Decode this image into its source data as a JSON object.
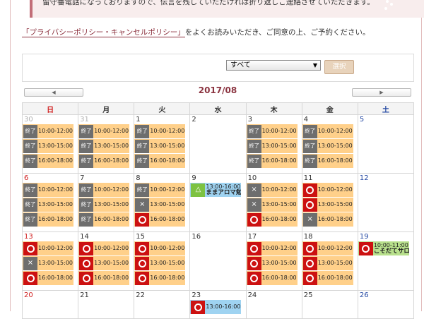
{
  "notice": {
    "text": "留守番電話になっておりますので、伝言を残していただければ折り返しご連絡させていただきます。"
  },
  "policy": {
    "link_text": "「プライバシーポリシー・キャンセルポリシー」",
    "suffix": "をよくお読みいただき、ご同意の上、ご予約ください。"
  },
  "filter": {
    "selected": "すべて",
    "button_label": "選択"
  },
  "nav": {
    "prev": "◀",
    "next": "▶",
    "month": "2017/08"
  },
  "weekdays": [
    "日",
    "月",
    "火",
    "水",
    "木",
    "金",
    "土"
  ],
  "status_labels": {
    "done": "終了",
    "available": "○",
    "full": "×",
    "few": "△"
  },
  "colors": {
    "slot": "#ffd08a",
    "available": "#cc1111",
    "done": "#6e6e6e",
    "few": "#7dc242",
    "event_blue": "#9fd3f1",
    "event_green": "#b8e08c"
  },
  "weeks": [
    [
      {
        "day": "30",
        "other": true,
        "slots": [
          {
            "status": "done",
            "label": "終了",
            "time": "10:00-12:00"
          },
          {
            "status": "done",
            "label": "終了",
            "time": "13:00-15:00"
          },
          {
            "status": "done",
            "label": "終了",
            "time": "16:00-18:00"
          }
        ]
      },
      {
        "day": "31",
        "other": true,
        "slots": [
          {
            "status": "done",
            "label": "終了",
            "time": "10:00-12:00"
          },
          {
            "status": "done",
            "label": "終了",
            "time": "13:00-15:00"
          },
          {
            "status": "done",
            "label": "終了",
            "time": "16:00-18:00"
          }
        ]
      },
      {
        "day": "1",
        "slots": [
          {
            "status": "done",
            "label": "終了",
            "time": "10:00-12:00"
          },
          {
            "status": "done",
            "label": "終了",
            "time": "13:00-15:00"
          },
          {
            "status": "done",
            "label": "終了",
            "time": "16:00-18:00"
          }
        ]
      },
      {
        "day": "2",
        "slots": []
      },
      {
        "day": "3",
        "slots": [
          {
            "status": "done",
            "label": "終了",
            "time": "10:00-12:00"
          },
          {
            "status": "done",
            "label": "終了",
            "time": "13:00-15:00"
          },
          {
            "status": "done",
            "label": "終了",
            "time": "16:00-18:00"
          }
        ]
      },
      {
        "day": "4",
        "slots": [
          {
            "status": "done",
            "label": "終了",
            "time": "10:00-12:00"
          },
          {
            "status": "done",
            "label": "終了",
            "time": "13:00-15:00"
          },
          {
            "status": "done",
            "label": "終了",
            "time": "16:00-18:00"
          }
        ]
      },
      {
        "day": "5",
        "slots": []
      }
    ],
    [
      {
        "day": "6",
        "slots": [
          {
            "status": "done",
            "label": "終了",
            "time": "10:00-12:00"
          },
          {
            "status": "done",
            "label": "終了",
            "time": "13:00-15:00"
          },
          {
            "status": "done",
            "label": "終了",
            "time": "16:00-18:00"
          }
        ]
      },
      {
        "day": "7",
        "slots": [
          {
            "status": "done",
            "label": "終了",
            "time": "10:00-12:00"
          },
          {
            "status": "done",
            "label": "終了",
            "time": "13:00-15:00"
          },
          {
            "status": "done",
            "label": "終了",
            "time": "16:00-18:00"
          }
        ]
      },
      {
        "day": "8",
        "slots": [
          {
            "status": "done",
            "label": "終了",
            "time": "10:00-12:00"
          },
          {
            "status": "full",
            "label": "×",
            "time": "13:00-15:00"
          },
          {
            "status": "available",
            "label": "○",
            "time": "16:00-18:00"
          }
        ]
      },
      {
        "day": "9",
        "slots": [
          {
            "status": "few",
            "label": "△",
            "time": "13:00-16:00",
            "title": "ままアロマ勉強",
            "event": "blue"
          }
        ]
      },
      {
        "day": "10",
        "slots": [
          {
            "status": "full",
            "label": "×",
            "time": "10:00-12:00"
          },
          {
            "status": "full",
            "label": "×",
            "time": "13:00-15:00"
          },
          {
            "status": "available",
            "label": "○",
            "time": "16:00-18:00"
          }
        ]
      },
      {
        "day": "11",
        "slots": [
          {
            "status": "available",
            "label": "○",
            "time": "10:00-12:00"
          },
          {
            "status": "available",
            "label": "○",
            "time": "13:00-15:00"
          },
          {
            "status": "full",
            "label": "×",
            "time": "16:00-18:00"
          }
        ]
      },
      {
        "day": "12",
        "slots": []
      }
    ],
    [
      {
        "day": "13",
        "slots": [
          {
            "status": "available",
            "label": "○",
            "time": "10:00-12:00"
          },
          {
            "status": "full",
            "label": "×",
            "time": "13:00-15:00"
          },
          {
            "status": "available",
            "label": "○",
            "time": "16:00-18:00"
          }
        ]
      },
      {
        "day": "14",
        "slots": [
          {
            "status": "available",
            "label": "○",
            "time": "10:00-12:00"
          },
          {
            "status": "available",
            "label": "○",
            "time": "13:00-15:00"
          },
          {
            "status": "available",
            "label": "○",
            "time": "16:00-18:00"
          }
        ]
      },
      {
        "day": "15",
        "slots": [
          {
            "status": "available",
            "label": "○",
            "time": "10:00-12:00"
          },
          {
            "status": "available",
            "label": "○",
            "time": "13:00-15:00"
          },
          {
            "status": "available",
            "label": "○",
            "time": "16:00-18:00"
          }
        ]
      },
      {
        "day": "16",
        "slots": []
      },
      {
        "day": "17",
        "slots": [
          {
            "status": "available",
            "label": "○",
            "time": "10:00-12:00"
          },
          {
            "status": "available",
            "label": "○",
            "time": "13:00-15:00"
          },
          {
            "status": "available",
            "label": "○",
            "time": "16:00-18:00"
          }
        ]
      },
      {
        "day": "18",
        "slots": [
          {
            "status": "available",
            "label": "○",
            "time": "10:00-12:00"
          },
          {
            "status": "available",
            "label": "○",
            "time": "13:00-15:00"
          },
          {
            "status": "available",
            "label": "○",
            "time": "16:00-18:00"
          }
        ]
      },
      {
        "day": "19",
        "slots": [
          {
            "status": "available",
            "label": "○",
            "time": "10:00-11:00",
            "title": "こそだてサロン",
            "event": "green"
          }
        ]
      }
    ],
    [
      {
        "day": "20",
        "slots": []
      },
      {
        "day": "21",
        "slots": []
      },
      {
        "day": "22",
        "slots": []
      },
      {
        "day": "23",
        "slots": [
          {
            "status": "available",
            "label": "○",
            "time": "13:00-16:00",
            "event": "blue"
          }
        ]
      },
      {
        "day": "24",
        "slots": []
      },
      {
        "day": "25",
        "slots": []
      },
      {
        "day": "26",
        "slots": []
      }
    ]
  ]
}
